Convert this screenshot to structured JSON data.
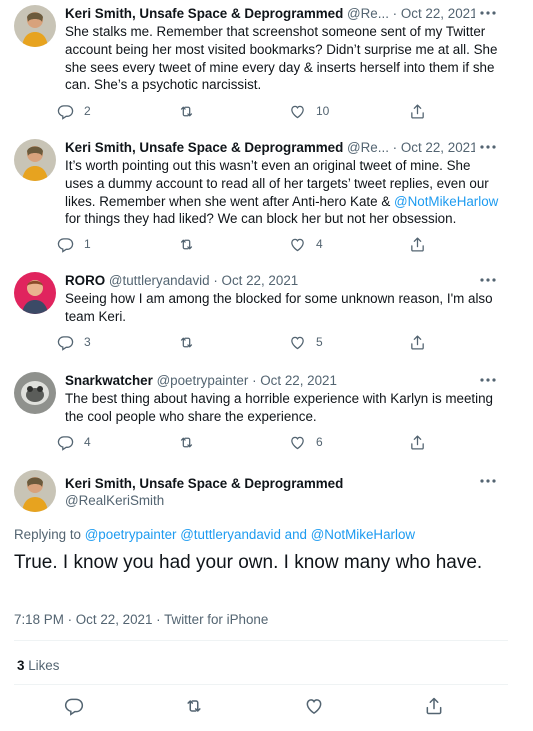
{
  "tweets": [
    {
      "name": "Keri Smith, Unsafe Space & Deprogrammed",
      "handle": "@Re...",
      "sep": "·",
      "date": "Oct 22, 2021",
      "text": "She stalks me. Remember that screenshot someone sent of my Twitter account being her most visited bookmarks? Didn’t surprise me at all. She she sees every tweet of mine every day & inserts herself into them if she can. She’s a psychotic narcissist.",
      "replies": "2",
      "retweets": "",
      "likes": "10"
    },
    {
      "name": "Keri Smith, Unsafe Space & Deprogrammed",
      "handle": "@Re...",
      "sep": "·",
      "date": "Oct 22, 2021",
      "text_before": "It’s worth pointing out this wasn’t even an original tweet of mine. She uses a dummy account to read all of her targets’ tweet replies, even our likes. Remember when she went after Anti-hero Kate & ",
      "mention": "@NotMikeHarlow",
      "text_after": " for things they had liked? We can block her but not her obsession.",
      "replies": "1",
      "retweets": "",
      "likes": "4"
    },
    {
      "name": "RORO",
      "handle": "@tuttleryandavid",
      "sep": "·",
      "date": "Oct 22, 2021",
      "text": "Seeing how I am among the blocked for some unknown reason, I'm also team Keri.",
      "replies": "3",
      "retweets": "",
      "likes": "5"
    },
    {
      "name": "Snarkwatcher",
      "handle": "@poetrypainter",
      "sep": "·",
      "date": "Oct 22, 2021",
      "text": "The best thing about having a horrible experience with Karlyn is meeting the cool people who share the experience.",
      "replies": "4",
      "retweets": "",
      "likes": "6"
    }
  ],
  "main": {
    "name": "Keri Smith, Unsafe Space & Deprogrammed",
    "handle": "@RealKeriSmith",
    "replying_label": "Replying to ",
    "replying_1": "@poetrypainter",
    "replying_2": "@tuttleryandavid",
    "replying_and": " and ",
    "replying_3": "@NotMikeHarlow",
    "text": "True. I know you had your own. I know many who have.",
    "meta": "7:18 PM · Oct 22, 2021 · Twitter for iPhone",
    "likes_count": "3",
    "likes_label": "Likes"
  },
  "colors": {
    "link": "#1d9bf0",
    "secondary": "#536471",
    "text": "#0f1419",
    "divider": "#eff3f4"
  },
  "icons": [
    "more-icon",
    "reply-icon",
    "retweet-icon",
    "like-icon",
    "share-icon"
  ]
}
